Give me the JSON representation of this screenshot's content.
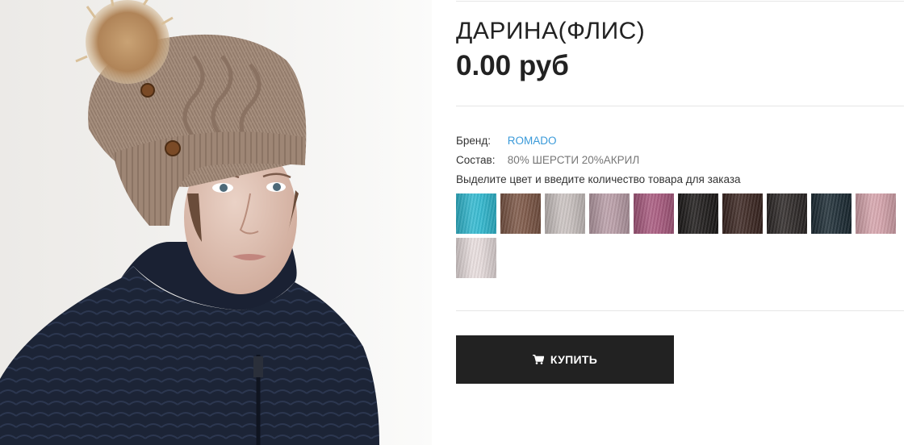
{
  "product": {
    "title": "ДАРИНА(ФЛИС)",
    "price": "0.00 руб",
    "brand_label": "Бренд:",
    "brand_value": "ROMADO",
    "composition_label": "Состав:",
    "composition_value": "80% ШЕРСТИ 20%АКРИЛ",
    "color_hint": "Выделите цвет и введите количество товара для заказа",
    "buy_label": "КУПИТЬ",
    "photo_icon": "product-photo"
  },
  "swatches": [
    {
      "color": "#2fb8cf"
    },
    {
      "color": "#7b5544"
    },
    {
      "color": "#c9c1bf"
    },
    {
      "color": "#b89ca6"
    },
    {
      "color": "#a7587d"
    },
    {
      "color": "#1c1918"
    },
    {
      "color": "#3a2520"
    },
    {
      "color": "#2b2625"
    },
    {
      "color": "#1b2a33"
    },
    {
      "color": "#d5a3ab"
    },
    {
      "color": "#e7dcdc"
    }
  ],
  "colors": {
    "accent_link": "#3a9ad9",
    "button_bg": "#222222",
    "text": "#222222"
  }
}
